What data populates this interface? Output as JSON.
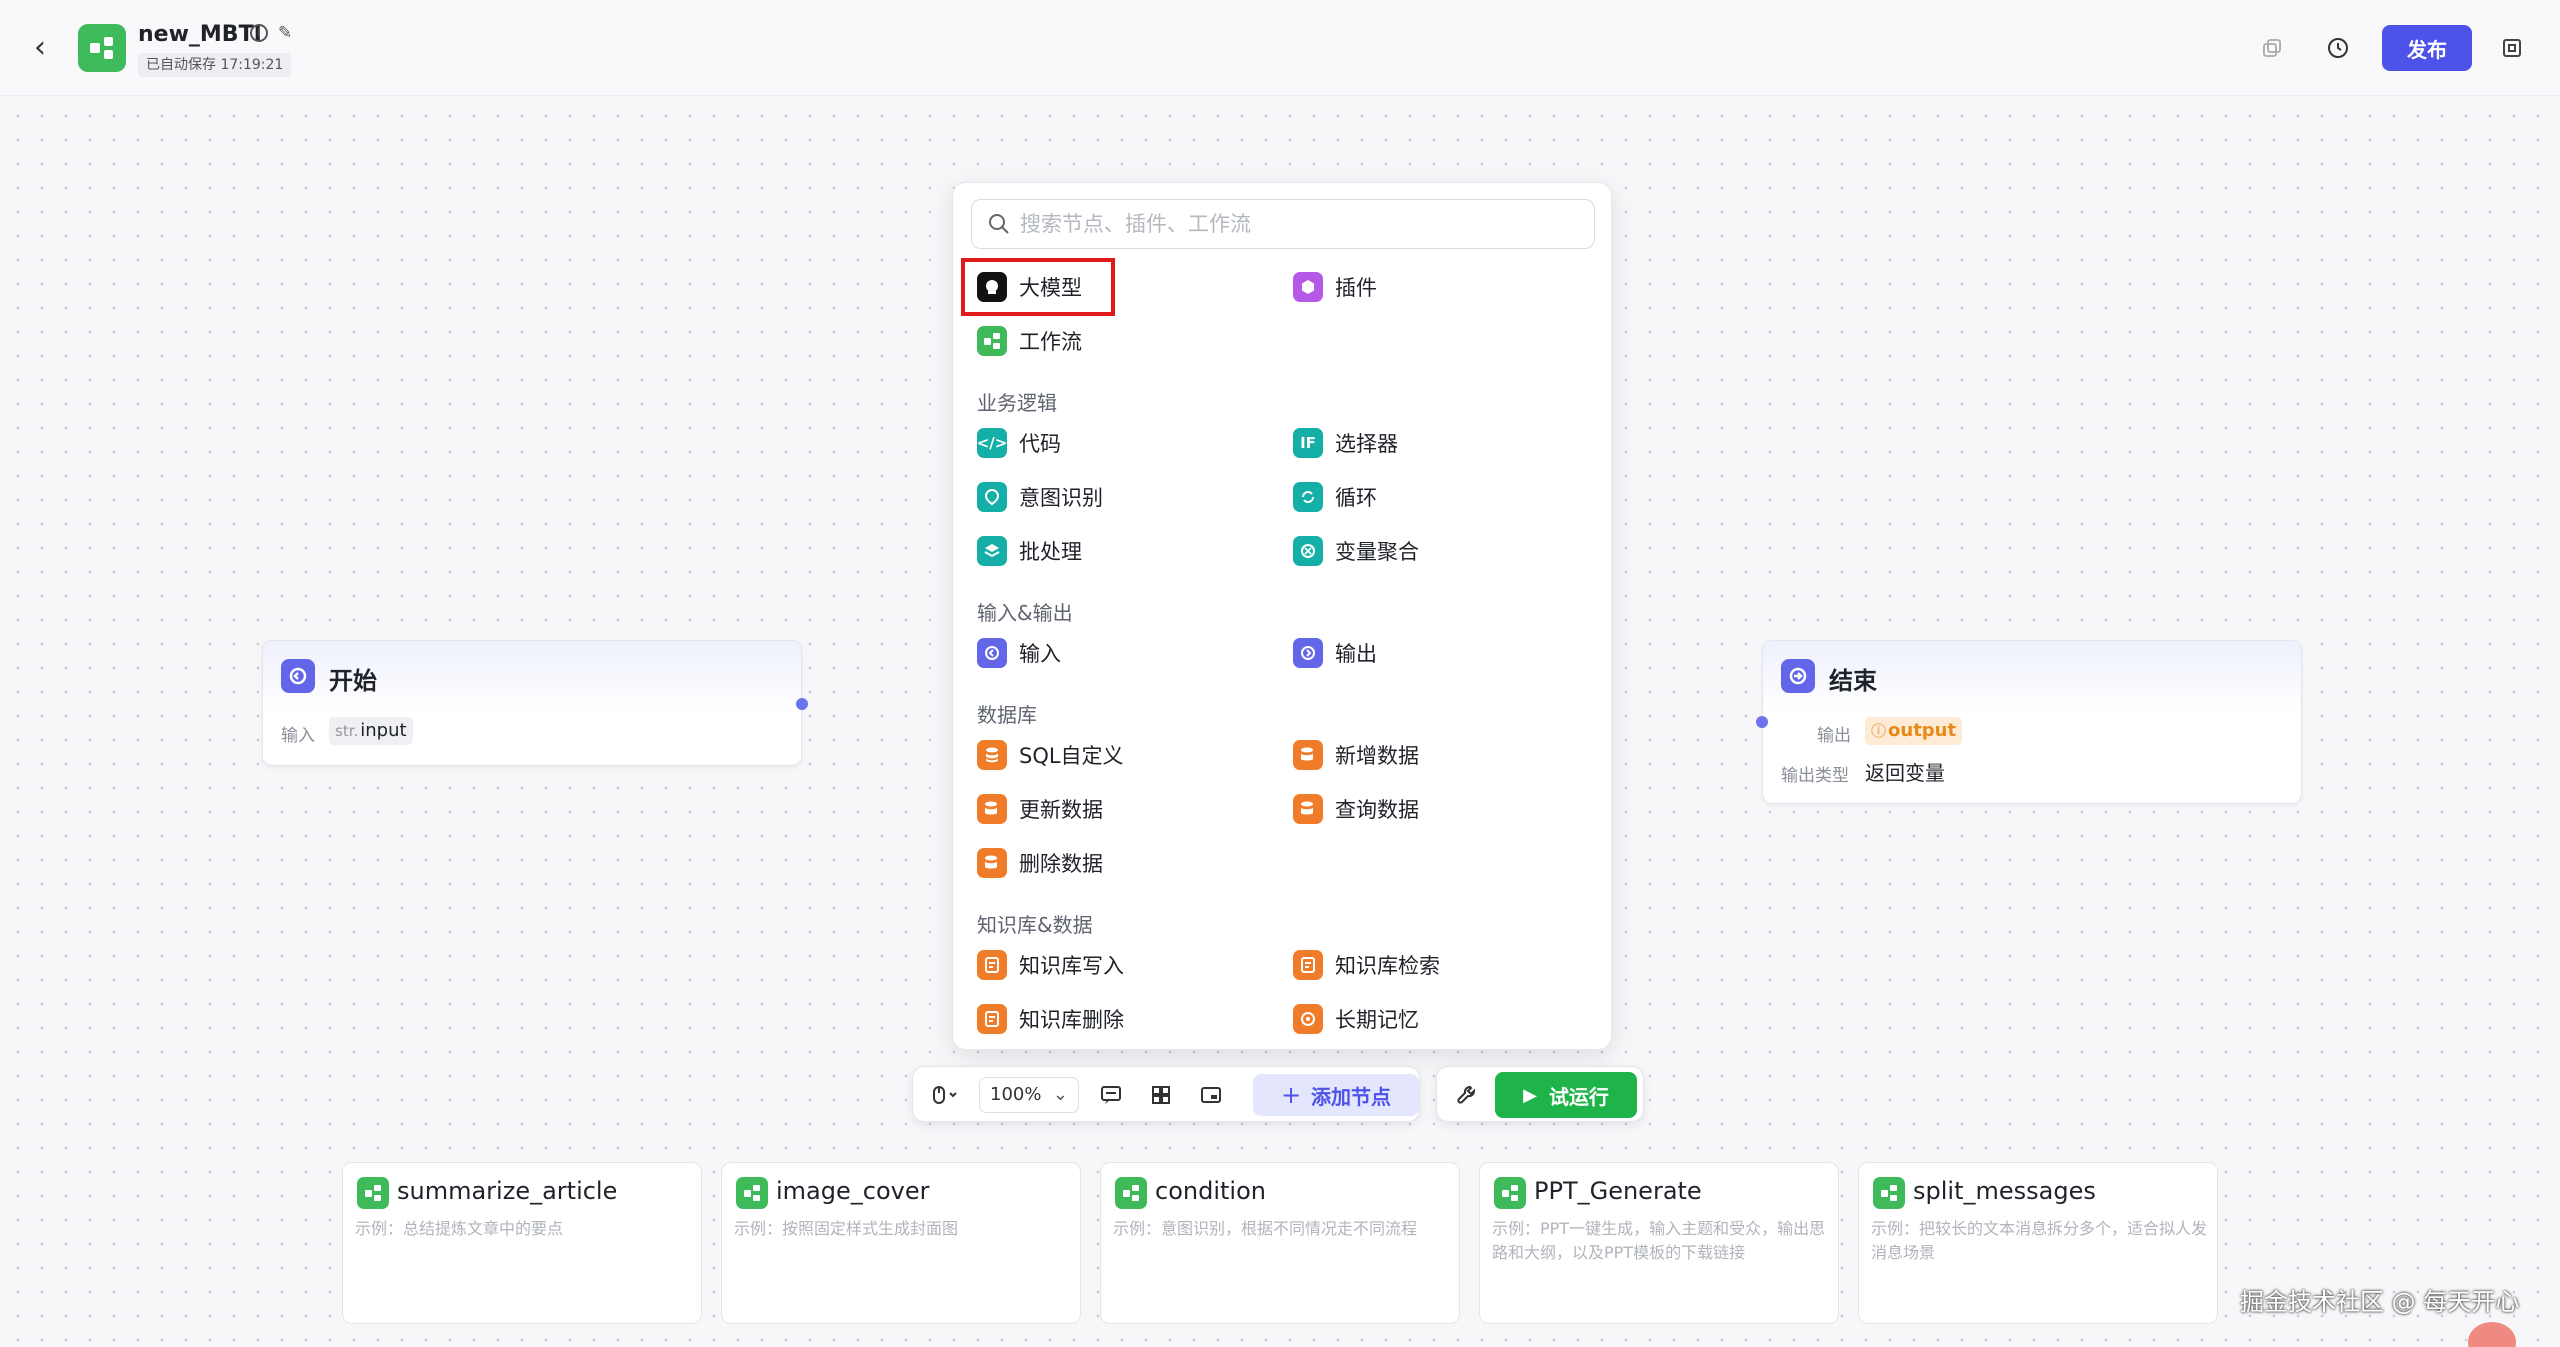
{
  "header": {
    "app_title": "new_MBTI",
    "save_status": "已自动保存 17:19:21",
    "publish_label": "发布"
  },
  "start_node": {
    "title": "开始",
    "input_label": "输入",
    "input_type": "str.",
    "input_name": "input"
  },
  "end_node": {
    "title": "结束",
    "output_label": "输出",
    "output_name": "output",
    "output_type_label": "输出类型",
    "output_type_value": "返回变量"
  },
  "panel": {
    "search_placeholder": "搜索节点、插件、工作流",
    "top_items": [
      {
        "label": "大模型",
        "icon": "llm-icon"
      },
      {
        "label": "插件",
        "icon": "plugin-icon"
      },
      {
        "label": "工作流",
        "icon": "workflow-icon"
      }
    ],
    "sections": [
      {
        "title": "业务逻辑",
        "items": [
          "代码",
          "选择器",
          "意图识别",
          "循环",
          "批处理",
          "变量聚合"
        ]
      },
      {
        "title": "输入&输出",
        "items": [
          "输入",
          "输出"
        ]
      },
      {
        "title": "数据库",
        "items": [
          "SQL自定义",
          "新增数据",
          "更新数据",
          "查询数据",
          "删除数据"
        ]
      },
      {
        "title": "知识库&数据",
        "items": [
          "知识库写入",
          "知识库检索",
          "知识库删除",
          "长期记忆"
        ]
      }
    ]
  },
  "toolbar": {
    "zoom": "100%",
    "add_node_label": "添加节点",
    "run_label": "试运行"
  },
  "templates": [
    {
      "title": "summarize_article",
      "desc": "示例：总结提炼文章中的要点"
    },
    {
      "title": "image_cover",
      "desc": "示例：按照固定样式生成封面图"
    },
    {
      "title": "condition",
      "desc": "示例：意图识别，根据不同情况走不同流程"
    },
    {
      "title": "PPT_Generate",
      "desc": "示例：PPT一键生成，输入主题和受众，输出思路和大纲，以及PPT模板的下载链接"
    },
    {
      "title": "split_messages",
      "desc": "示例：把较长的文本消息拆分多个，适合拟人发消息场景"
    }
  ],
  "watermark": "掘金技术社区 @ 每天开心",
  "colors": {
    "accent": "#4d53e8",
    "run": "#1fb44a",
    "workflow": "#3fba5a",
    "db": "#f07c2a",
    "logic": "#14b0a8",
    "io": "#6366e8",
    "highlight": "#e0191b"
  }
}
